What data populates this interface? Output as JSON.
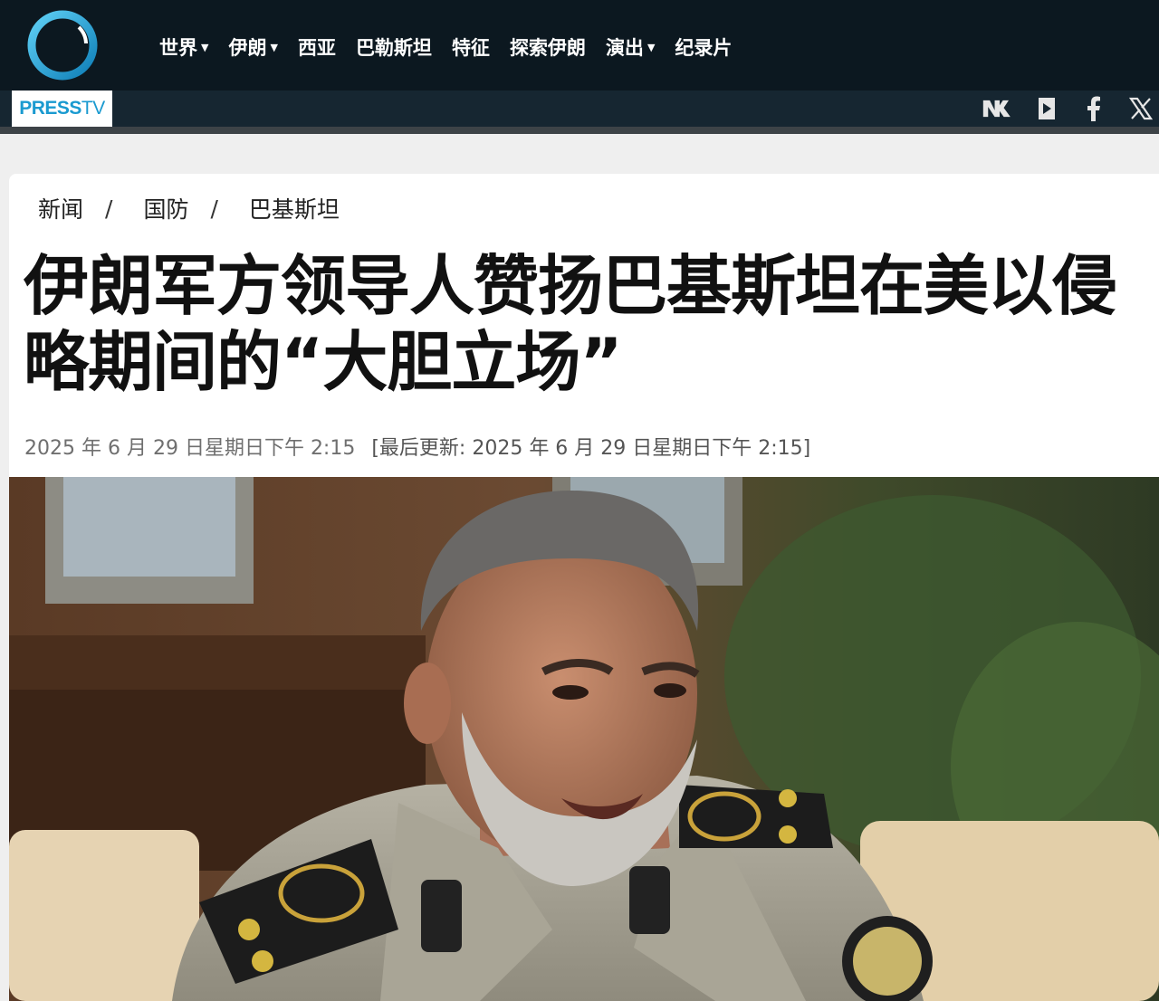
{
  "header": {
    "logo": {
      "brand_bold": "PRESS",
      "brand_light": "TV"
    },
    "nav": [
      {
        "label": "世界",
        "has_dropdown": true
      },
      {
        "label": "伊朗",
        "has_dropdown": true
      },
      {
        "label": "西亚",
        "has_dropdown": false
      },
      {
        "label": "巴勒斯坦",
        "has_dropdown": false
      },
      {
        "label": "特征",
        "has_dropdown": false
      },
      {
        "label": "探索伊朗",
        "has_dropdown": false
      },
      {
        "label": "演出",
        "has_dropdown": true
      },
      {
        "label": "纪录片",
        "has_dropdown": false
      }
    ],
    "social_icons": [
      "vk-icon",
      "rumble-icon",
      "facebook-icon",
      "x-icon"
    ]
  },
  "article": {
    "breadcrumb": [
      "新闻",
      "国防",
      "巴基斯坦"
    ],
    "title": "伊朗军方领导人赞扬巴基斯坦在美以侵略期间的“大胆立场”",
    "published": "2025 年 6 月 29 日星期日下午 2:15",
    "updated": "[最后更新: 2025 年 6 月 29 日星期日下午 2:15]"
  },
  "colors": {
    "header_bg": "#0c1820",
    "header_bar": "#162631",
    "logo_blue": "#1a9ad0",
    "page_bg": "#efefef"
  }
}
